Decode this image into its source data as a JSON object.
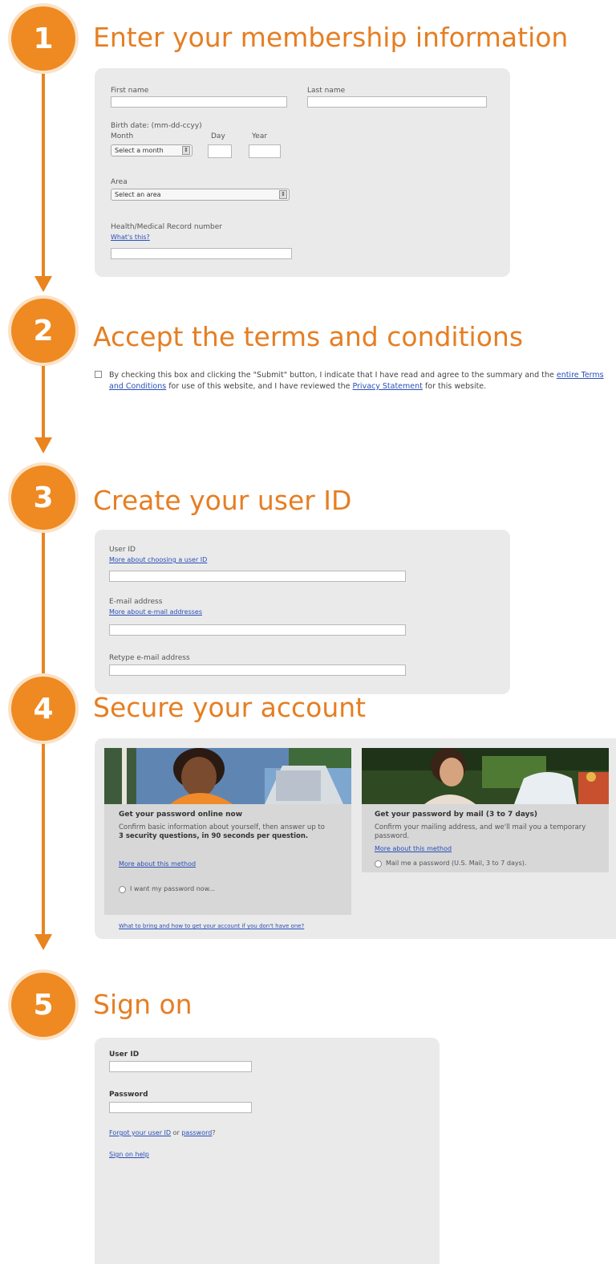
{
  "colors": {
    "accent": "#ee8a21",
    "panel": "#eaeaea",
    "link": "#2a4fb7"
  },
  "steps": [
    {
      "number": "1",
      "title": "Enter your membership information"
    },
    {
      "number": "2",
      "title": "Accept the terms and conditions"
    },
    {
      "number": "3",
      "title": "Create your user ID"
    },
    {
      "number": "4",
      "title": "Secure your account"
    },
    {
      "number": "5",
      "title": "Sign on"
    }
  ],
  "membership": {
    "first_name_label": "First name",
    "last_name_label": "Last name",
    "birth_date_label": "Birth date: (mm-dd-ccyy)",
    "month_label": "Month",
    "day_label": "Day",
    "year_label": "Year",
    "month_select": "Select a month",
    "area_label": "Area",
    "area_select": "Select an area",
    "record_label": "Health/Medical Record number",
    "whats_this": "What's this?"
  },
  "terms": {
    "text_before": "By checking this box and clicking the \"Submit\" button, I indicate that I have read and agree to the summary and the ",
    "terms_link": "entire Terms and Conditions",
    "text_middle": " for use of this website, and I have reviewed the ",
    "privacy_link": "Privacy Statement",
    "text_after": " for this website."
  },
  "user_id": {
    "user_id_label": "User ID",
    "user_id_help": "More about choosing a user ID",
    "email_label": "E-mail address",
    "email_help": "More about e-mail addresses",
    "retype_label": "Retype e-mail address"
  },
  "secure": {
    "online": {
      "title": "Get your password online now",
      "text_before": "Confirm basic information about yourself, then answer up to ",
      "text_bold": "3 security questions, in 90 seconds per question.",
      "more": "More about this method",
      "option": "I want my password now..."
    },
    "mail": {
      "title": "Get your password by mail (3 to 7 days)",
      "text": "Confirm your mailing address, and we'll mail you a temporary password.",
      "more": "More about this method",
      "option": "Mail me a password (U.S. Mail, 3 to 7 days)."
    },
    "help_link": "What to bring and how to get your account if you don't have one?"
  },
  "sign_on": {
    "user_id_label": "User ID",
    "password_label": "Password",
    "forgot_user_id": "Forgot your user ID",
    "or_text": "or",
    "forgot_password": "password",
    "question_mark": "?",
    "help": "Sign on help"
  }
}
